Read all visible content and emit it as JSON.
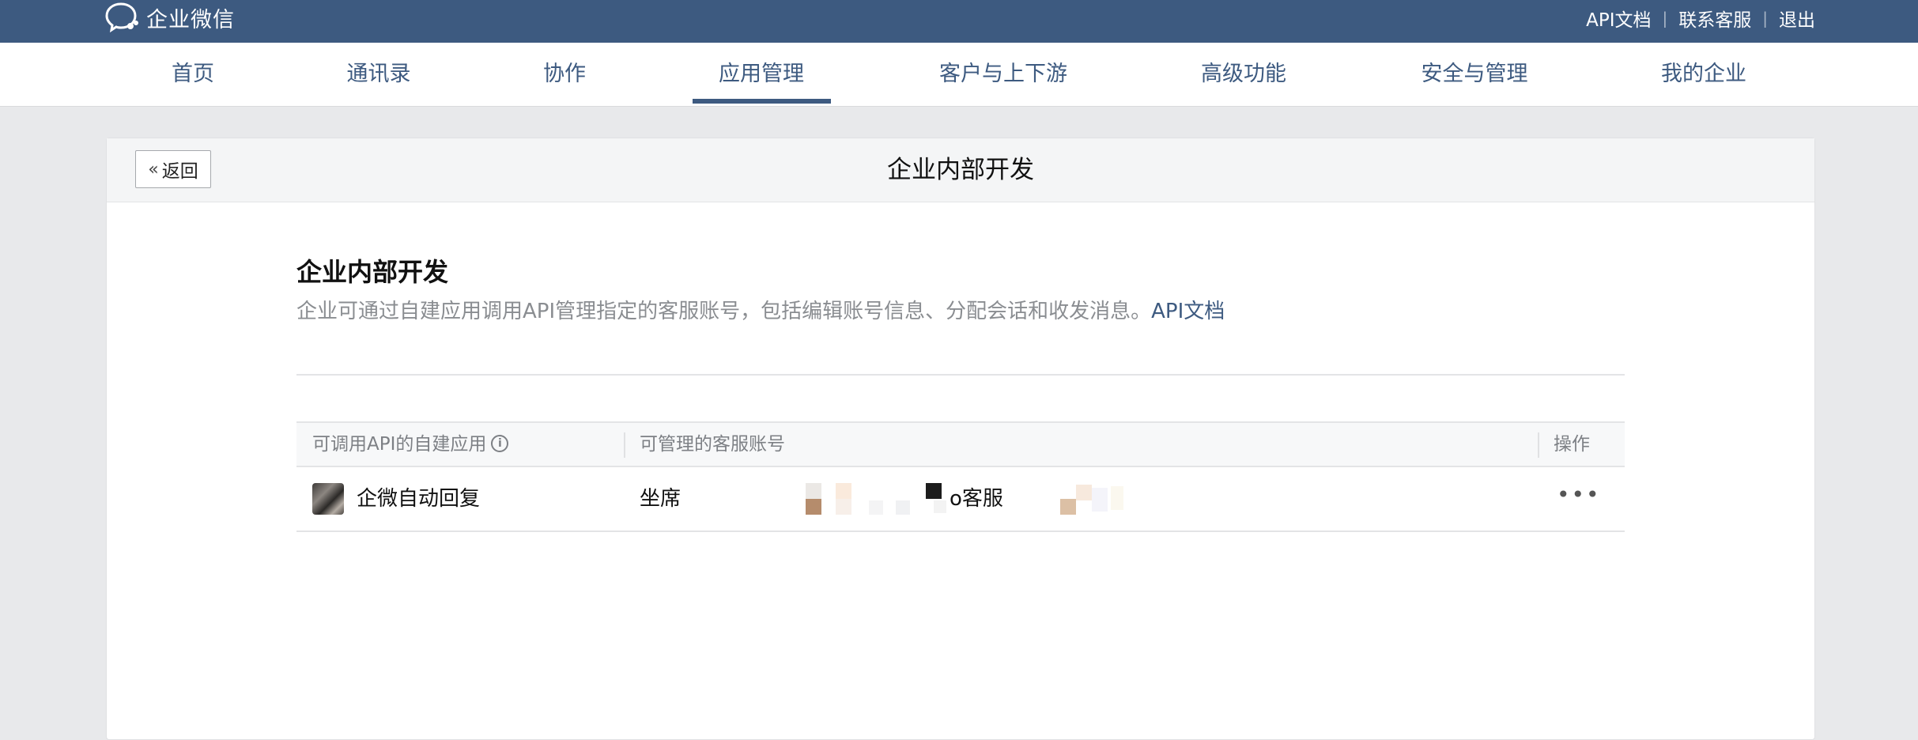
{
  "topbar": {
    "logo_text": "企业微信",
    "links": {
      "api_docs": "API文档",
      "support": "联系客服",
      "logout": "退出"
    },
    "separator": "|"
  },
  "nav": {
    "items": [
      {
        "label": "首页"
      },
      {
        "label": "通讯录"
      },
      {
        "label": "协作"
      },
      {
        "label": "应用管理",
        "active": true
      },
      {
        "label": "客户与上下游"
      },
      {
        "label": "高级功能"
      },
      {
        "label": "安全与管理"
      },
      {
        "label": "我的企业"
      }
    ]
  },
  "card": {
    "back_label": "返回",
    "title": "企业内部开发"
  },
  "section": {
    "title": "企业内部开发",
    "description": "企业可通过自建应用调用API管理指定的客服账号，包括编辑账号信息、分配会话和收发消息。",
    "doc_link": "API文档"
  },
  "table": {
    "headers": {
      "app": "可调用API的自建应用",
      "accounts": "可管理的客服账号",
      "actions": "操作"
    },
    "rows": [
      {
        "app_name": "企微自动回复",
        "accounts_prefix": "坐席",
        "accounts_suffix": "o客服",
        "actions": "•••"
      }
    ]
  },
  "colors": {
    "brand": "#3d5a80",
    "background": "#e8e9eb"
  },
  "icons": {
    "logo": "chat-bubble-icon",
    "info": "info-icon",
    "back": "double-chevron-left-icon",
    "more": "more-dots-icon"
  }
}
